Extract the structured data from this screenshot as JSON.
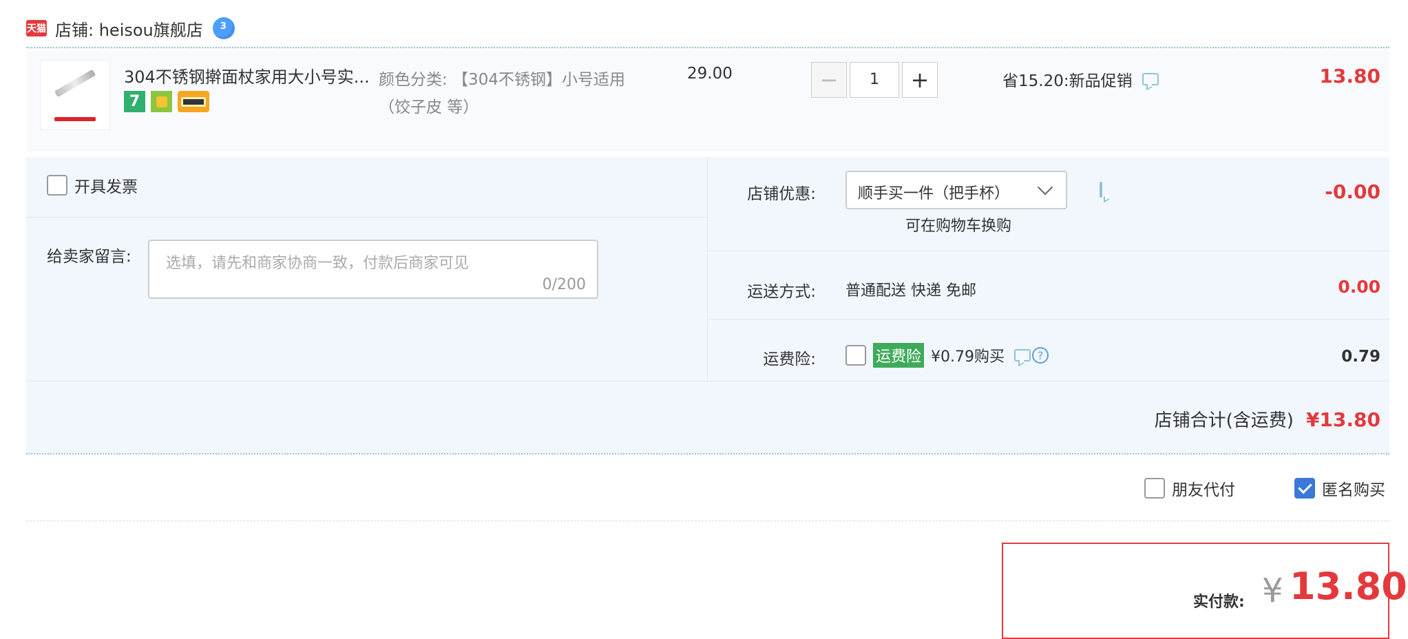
{
  "shop": {
    "logo_text": "天猫",
    "label": "店铺: heisou旗舰店",
    "wangwang_icon": "wangwang-chat-icon"
  },
  "item": {
    "title": "304不锈钢擀面杖家用大小号实...",
    "sku": "颜色分类: 【304不锈钢】小号适用（饺子皮 等）",
    "price": "29.00",
    "quantity": "1",
    "minus": "−",
    "plus": "+",
    "badge_7": "7",
    "promo": "省15.20:新品促销",
    "total": "13.80"
  },
  "options": {
    "invoice_label": "开具发票",
    "message_label": "给卖家留言:",
    "message_placeholder": "选填，请先和商家协商一致，付款后商家可见",
    "message_count": "0/200",
    "discount_label": "店铺优惠:",
    "discount_selected": "顺手买一件（把手杯）",
    "discount_note": "可在购物车换购",
    "discount_value": "-0.00",
    "shipping_label": "运送方式:",
    "shipping_method": "普通配送 快递 免邮",
    "shipping_value": "0.00",
    "insurance_label": "运费险:",
    "insurance_tag": "运费险",
    "insurance_price": "¥0.79购买",
    "insurance_help": "?",
    "insurance_value": "0.79"
  },
  "subtotal": {
    "label": "店铺合计(含运费)",
    "value": "¥13.80"
  },
  "checkout": {
    "friend_pay": "朋友代付",
    "friend_pay_checked": false,
    "anonymous": "匿名购买",
    "anonymous_checked": true,
    "pay_label": "实付款:",
    "pay_currency": "¥",
    "pay_value": "13.80"
  },
  "colors": {
    "accent_red": "#e4393c",
    "panel_bg": "#f2f7fe",
    "checkbox_blue": "#3c78d8",
    "insurance_green": "#3fab5a"
  }
}
